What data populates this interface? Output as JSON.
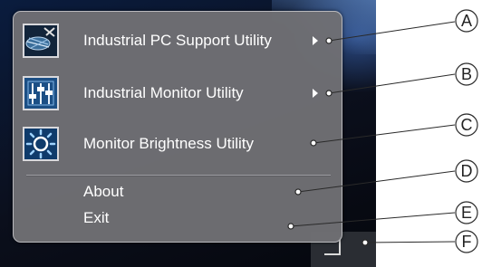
{
  "menu": {
    "items": [
      {
        "label": "Industrial PC Support Utility",
        "icon": "industrial-pc-support-icon",
        "has_submenu": true
      },
      {
        "label": "Industrial Monitor Utility",
        "icon": "monitor-utility-sliders-icon",
        "has_submenu": true
      },
      {
        "label": "Monitor Brightness Utility",
        "icon": "brightness-sun-icon",
        "has_submenu": false
      }
    ],
    "about_label": "About",
    "exit_label": "Exit"
  },
  "callouts": {
    "letters": [
      "A",
      "B",
      "C",
      "D",
      "E",
      "F"
    ]
  },
  "colors": {
    "menu_bg": "#707074",
    "menu_text": "#ffffff",
    "desktop_bg": "#0b0f1c"
  }
}
